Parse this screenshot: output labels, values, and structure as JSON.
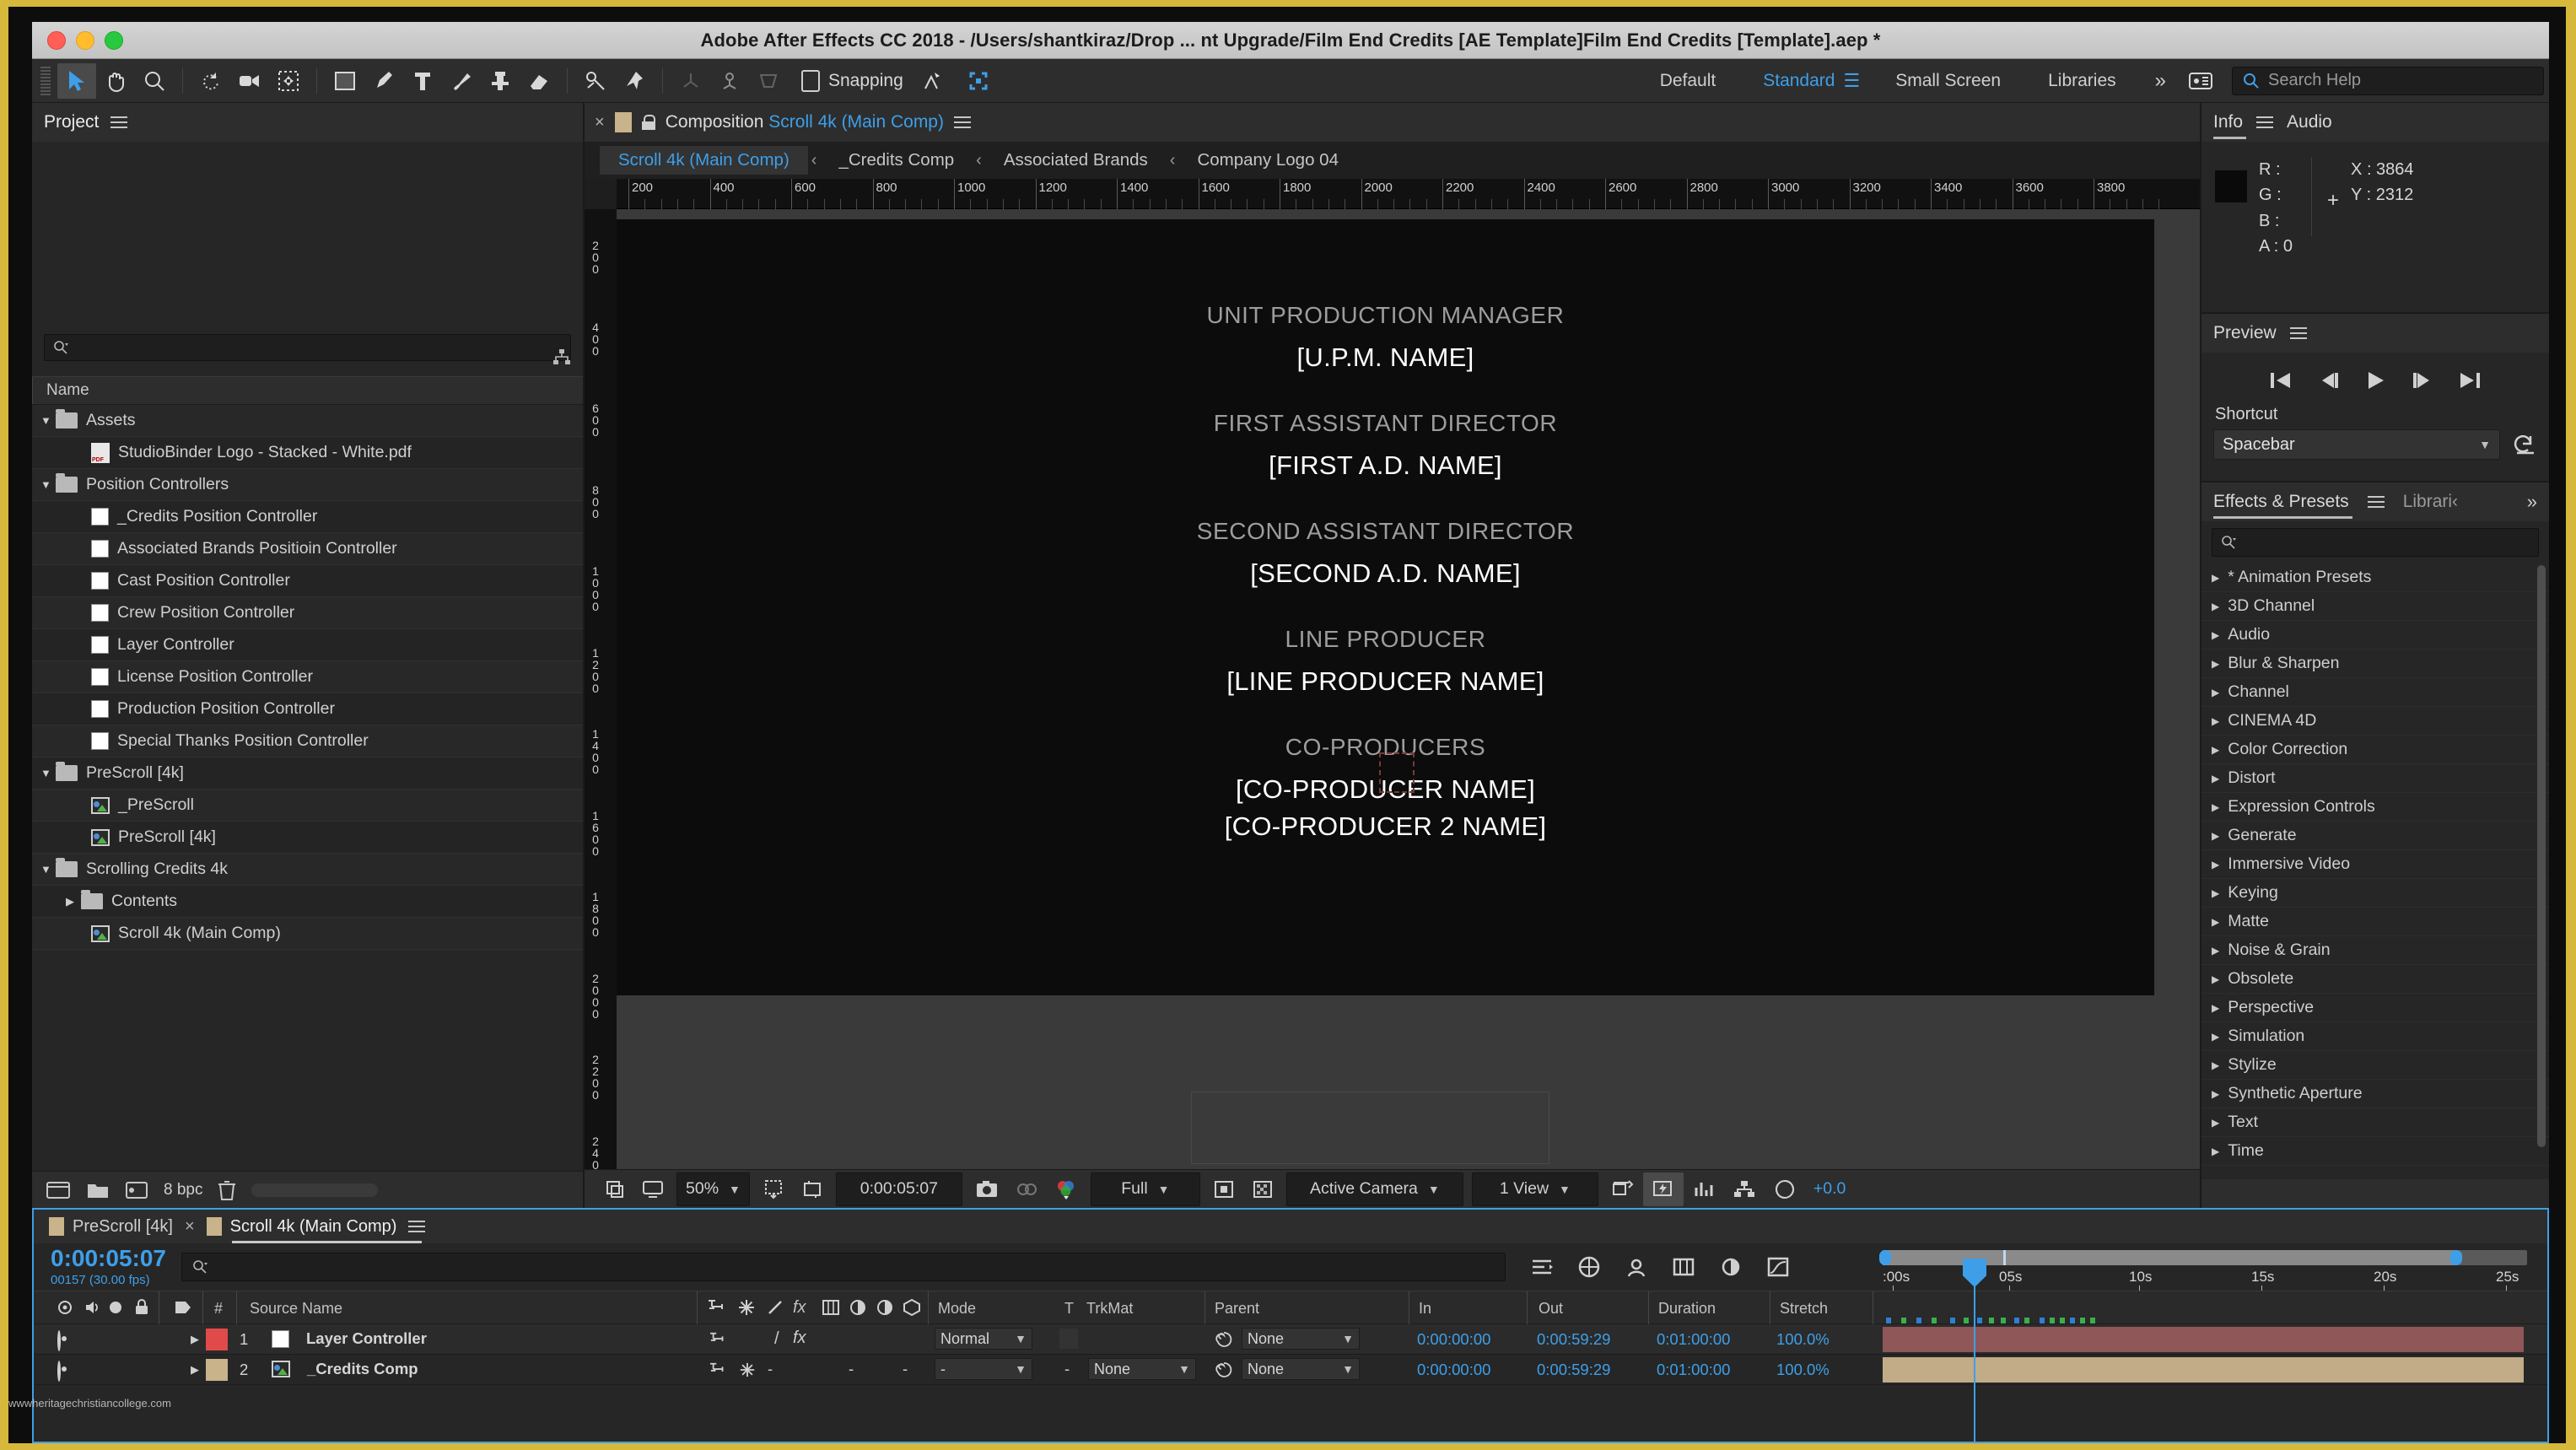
{
  "window": {
    "title": "Adobe After Effects CC 2018 - /Users/shantkiraz/Drop ... nt Upgrade/Film End Credits [AE Template]Film End Credits [Template].aep *"
  },
  "toolbar": {
    "snapping_label": "Snapping",
    "workspaces": [
      {
        "label": "Default",
        "selected": false
      },
      {
        "label": "Standard",
        "selected": true
      },
      {
        "label": "Small Screen",
        "selected": false
      },
      {
        "label": "Libraries",
        "selected": false
      }
    ],
    "more_label": "»",
    "search_placeholder": "Search Help"
  },
  "project": {
    "tab_label": "Project",
    "search_placeholder": "",
    "column_name": "Name",
    "items": [
      {
        "label": "Assets",
        "type": "folder",
        "indent": 0,
        "expanded": true
      },
      {
        "label": "StudioBinder Logo - Stacked - White.pdf",
        "type": "pdf",
        "indent": 1
      },
      {
        "label": "Position Controllers",
        "type": "folder",
        "indent": 0,
        "expanded": true
      },
      {
        "label": "_Credits Position Controller",
        "type": "swatch",
        "indent": 1
      },
      {
        "label": "Associated Brands Positioin Controller",
        "type": "swatch",
        "indent": 1
      },
      {
        "label": "Cast Position Controller",
        "type": "swatch",
        "indent": 1
      },
      {
        "label": "Crew Position Controller",
        "type": "swatch",
        "indent": 1
      },
      {
        "label": "Layer Controller",
        "type": "swatch",
        "indent": 1
      },
      {
        "label": "License Position Controller",
        "type": "swatch",
        "indent": 1
      },
      {
        "label": "Production Position Controller",
        "type": "swatch",
        "indent": 1
      },
      {
        "label": "Special Thanks Position Controller",
        "type": "swatch",
        "indent": 1
      },
      {
        "label": "PreScroll [4k]",
        "type": "folder",
        "indent": 0,
        "expanded": true
      },
      {
        "label": "_PreScroll",
        "type": "comp",
        "indent": 1
      },
      {
        "label": "PreScroll [4k]",
        "type": "comp",
        "indent": 1
      },
      {
        "label": "Scrolling Credits 4k",
        "type": "folder",
        "indent": 0,
        "expanded": true
      },
      {
        "label": "Contents",
        "type": "folder",
        "indent": 1,
        "expanded": false
      },
      {
        "label": "Scroll 4k (Main Comp)",
        "type": "comp",
        "indent": 1
      }
    ],
    "footer_bpc": "8 bpc"
  },
  "composition": {
    "panel_label": "Composition",
    "comp_name": "Scroll 4k (Main Comp)",
    "breadcrumbs": [
      {
        "label": "Scroll 4k (Main Comp)",
        "selected": true
      },
      {
        "label": "_Credits Comp",
        "selected": false
      },
      {
        "label": "Associated Brands",
        "selected": false
      },
      {
        "label": "Company Logo 04",
        "selected": false
      }
    ],
    "ruler_marks": [
      200,
      400,
      600,
      800,
      1000,
      1200,
      1400,
      1600,
      1800,
      2000,
      2200,
      2400,
      2600,
      2800,
      3000,
      3200,
      3400,
      3600,
      3800
    ],
    "vruler_marks": [
      "200",
      "400",
      "600",
      "800",
      "1000",
      "1200",
      "1400",
      "1600",
      "1800",
      "2000",
      "2200",
      "2400"
    ],
    "credits": [
      {
        "role": "UNIT PRODUCTION MANAGER",
        "names": [
          "[U.P.M. NAME]"
        ]
      },
      {
        "role": "FIRST ASSISTANT DIRECTOR",
        "names": [
          "[FIRST A.D. NAME]"
        ]
      },
      {
        "role": "SECOND ASSISTANT DIRECTOR",
        "names": [
          "[SECOND A.D. NAME]"
        ]
      },
      {
        "role": "LINE PRODUCER",
        "names": [
          "[LINE PRODUCER NAME]"
        ]
      },
      {
        "role": "CO-PRODUCERS",
        "names": [
          "[CO-PRODUCER NAME]",
          "[CO-PRODUCER 2 NAME]"
        ]
      }
    ],
    "footer": {
      "zoom": "50%",
      "timecode": "0:00:05:07",
      "resolution": "Full",
      "camera": "Active Camera",
      "views": "1 View",
      "exposure": "+0.0"
    }
  },
  "info": {
    "tabs": [
      {
        "label": "Info",
        "selected": true
      },
      {
        "label": "Audio",
        "selected": false
      }
    ],
    "r_label": "R :",
    "g_label": "G :",
    "b_label": "B :",
    "a_label": "A :",
    "a_value": "0",
    "x_label": "X : 3864",
    "y_label": "Y :  2312"
  },
  "preview": {
    "tab_label": "Preview",
    "shortcut_label": "Shortcut",
    "shortcut_value": "Spacebar"
  },
  "effects": {
    "tabs": [
      {
        "label": "Effects & Presets",
        "selected": true
      },
      {
        "label": "Librari‹",
        "selected": false
      }
    ],
    "search_placeholder": "",
    "categories": [
      "* Animation Presets",
      "3D Channel",
      "Audio",
      "Blur & Sharpen",
      "Channel",
      "CINEMA 4D",
      "Color Correction",
      "Distort",
      "Expression Controls",
      "Generate",
      "Immersive Video",
      "Keying",
      "Matte",
      "Noise & Grain",
      "Obsolete",
      "Perspective",
      "Simulation",
      "Stylize",
      "Synthetic Aperture",
      "Text",
      "Time"
    ]
  },
  "timeline": {
    "tabs": [
      {
        "label": "PreScroll [4k]",
        "selected": false
      },
      {
        "label": "Scroll 4k (Main Comp)",
        "selected": true
      }
    ],
    "current_time": "0:00:05:07",
    "frame_info": "00157 (30.00 fps)",
    "search_placeholder": "",
    "columns": [
      "#",
      "Source Name",
      "Mode",
      "T",
      "TrkMat",
      "Parent",
      "In",
      "Out",
      "Duration",
      "Stretch"
    ],
    "time_labels": [
      ":00s",
      "05s",
      "10s",
      "15s",
      "20s",
      "25s"
    ],
    "layers": [
      {
        "index": "1",
        "name": "Layer Controller",
        "type": "swatch",
        "label_color": "#e04a4a",
        "mode": "Normal",
        "trkmat": "",
        "parent": "None",
        "in": "0:00:00:00",
        "out": "0:00:59:29",
        "duration": "0:01:00:00",
        "stretch": "100.0%",
        "bar_color": "#8f5757"
      },
      {
        "index": "2",
        "name": "_Credits Comp",
        "type": "comp",
        "label_color": "#c8b38a",
        "mode": "-",
        "trkmat": "None",
        "parent": "None",
        "in": "0:00:00:00",
        "out": "0:00:59:29",
        "duration": "0:01:00:00",
        "stretch": "100.0%",
        "bar_color": "#c2ab87"
      }
    ]
  },
  "watermark": "wwwheritagechristiancollege.com",
  "colors": {
    "accent_blue": "#3e9fe8",
    "panel_bg": "#262626",
    "header_bg": "#2d2d2d",
    "frame_yellow": "#d6b83a"
  }
}
